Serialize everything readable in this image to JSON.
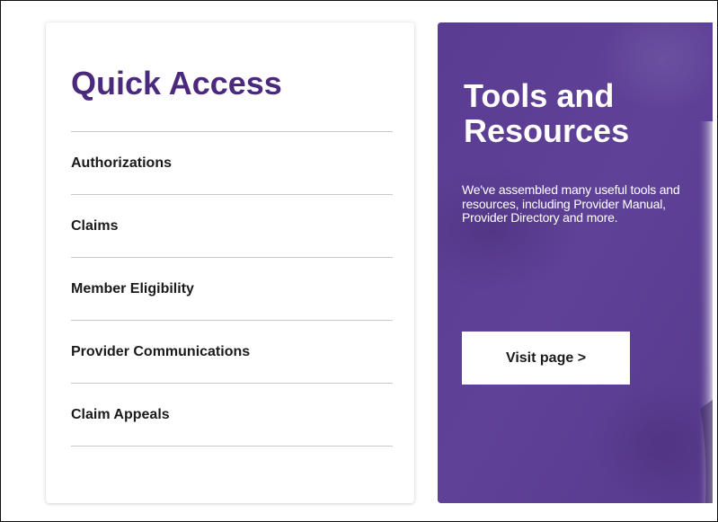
{
  "quick_access": {
    "title": "Quick Access",
    "items": [
      {
        "label": "Authorizations"
      },
      {
        "label": "Claims"
      },
      {
        "label": "Member Eligibility"
      },
      {
        "label": "Provider Communications"
      },
      {
        "label": "Claim Appeals"
      }
    ]
  },
  "tools": {
    "title_line1": "Tools and",
    "title_line2": "Resources",
    "description": "We've assembled many useful tools and resources, including Provider Manual, Provider Directory and more.",
    "button_label": "Visit page >"
  },
  "colors": {
    "brand_purple": "#4b2a7e",
    "panel_purple": "#5d3f95",
    "divider": "#c9c9c9"
  }
}
